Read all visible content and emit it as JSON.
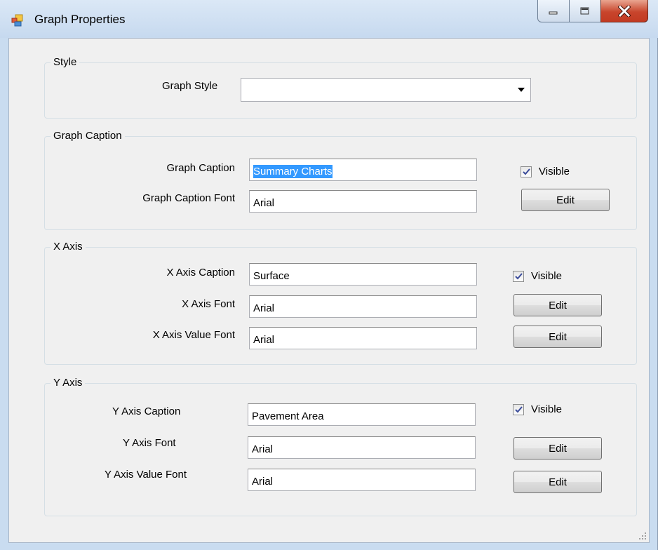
{
  "window": {
    "title": "Graph Properties",
    "app_icon": "app-form-icon"
  },
  "style_group": {
    "title": "Style",
    "graph_style_label": "Graph Style",
    "graph_style_value": ""
  },
  "caption_group": {
    "title": "Graph Caption",
    "caption_label": "Graph Caption",
    "caption_value": "Summary Charts",
    "font_label": "Graph Caption Font",
    "font_value": "Arial",
    "visible_label": "Visible",
    "visible_checked": true,
    "edit_label": "Edit"
  },
  "x_axis_group": {
    "title": "X Axis",
    "caption_label": "X Axis Caption",
    "caption_value": "Surface",
    "font_label": "X Axis Font",
    "font_value": "Arial",
    "value_font_label": "X Axis Value Font",
    "value_font_value": "Arial",
    "visible_label": "Visible",
    "visible_checked": true,
    "edit_font_label": "Edit",
    "edit_value_font_label": "Edit"
  },
  "y_axis_group": {
    "title": "Y Axis",
    "caption_label": "Y Axis Caption",
    "caption_value": "Pavement Area",
    "font_label": "Y Axis Font",
    "font_value": "Arial",
    "value_font_label": "Y Axis Value Font",
    "value_font_value": "Arial",
    "visible_label": "Visible",
    "visible_checked": true,
    "edit_font_label": "Edit",
    "edit_value_font_label": "Edit"
  },
  "colors": {
    "title_bar": "#c6d9ef",
    "client_bg": "#f0f0f0",
    "close_button": "#c8452c",
    "selection": "#3399ff"
  }
}
